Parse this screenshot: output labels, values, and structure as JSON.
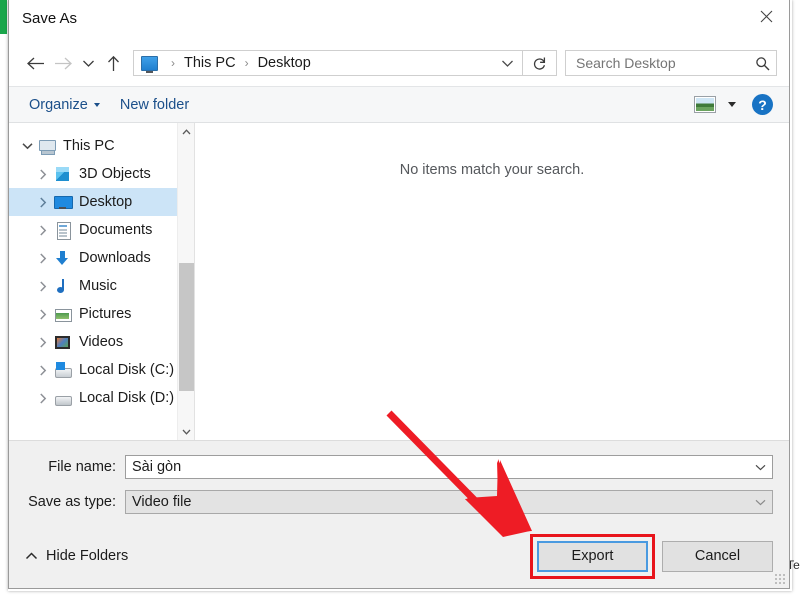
{
  "window": {
    "title": "Save As",
    "close_label": "Close"
  },
  "nav": {
    "back_label": "Back",
    "forward_label": "Forward",
    "recent_label": "Recent locations",
    "up_label": "Up",
    "refresh_label": "Refresh"
  },
  "address": {
    "icon": "desktop-monitor-icon",
    "crumbs": [
      "This PC",
      "Desktop"
    ],
    "separator": "›",
    "dropdown_icon": "chevron-down-icon",
    "refresh_icon": "refresh-icon"
  },
  "search": {
    "placeholder": "Search Desktop",
    "icon": "search-icon"
  },
  "toolbar": {
    "organize_label": "Organize",
    "new_folder_label": "New folder",
    "view_icon": "picture-view-icon",
    "view_caret_icon": "chevron-down-icon",
    "help_label": "?",
    "help_icon": "help-icon"
  },
  "sidebar": {
    "items": [
      {
        "label": "This PC",
        "icon": "computer-icon",
        "level": 0,
        "expander": "⌄",
        "expanded": true,
        "selected": false
      },
      {
        "label": "3D Objects",
        "icon": "3d-objects-icon",
        "level": 1,
        "expander": "›",
        "expanded": false,
        "selected": false
      },
      {
        "label": "Desktop",
        "icon": "desktop-icon",
        "level": 1,
        "expander": "›",
        "expanded": false,
        "selected": true
      },
      {
        "label": "Documents",
        "icon": "documents-icon",
        "level": 1,
        "expander": "›",
        "expanded": false,
        "selected": false
      },
      {
        "label": "Downloads",
        "icon": "downloads-icon",
        "level": 1,
        "expander": "›",
        "expanded": false,
        "selected": false
      },
      {
        "label": "Music",
        "icon": "music-icon",
        "level": 1,
        "expander": "›",
        "expanded": false,
        "selected": false
      },
      {
        "label": "Pictures",
        "icon": "pictures-icon",
        "level": 1,
        "expander": "›",
        "expanded": false,
        "selected": false
      },
      {
        "label": "Videos",
        "icon": "videos-icon",
        "level": 1,
        "expander": "›",
        "expanded": false,
        "selected": false
      },
      {
        "label": "Local Disk (C:)",
        "icon": "disk-c-icon",
        "level": 1,
        "expander": "›",
        "expanded": false,
        "selected": false
      },
      {
        "label": "Local Disk (D:)",
        "icon": "disk-d-icon",
        "level": 1,
        "expander": "›",
        "expanded": false,
        "selected": false
      }
    ],
    "scrollbar": {
      "up_icon": "chevron-up-icon",
      "down_icon": "chevron-down-icon"
    }
  },
  "file_list": {
    "empty_message": "No items match your search."
  },
  "form": {
    "file_name_label": "File name:",
    "file_name_value": "Sài gòn",
    "save_as_type_label": "Save as type:",
    "save_as_type_value": "Video file",
    "dropdown_icon": "chevron-down-icon"
  },
  "footer": {
    "hide_folders_label": "Hide Folders",
    "hide_folders_icon": "chevron-up-icon",
    "export_label": "Export",
    "cancel_label": "Cancel",
    "resize_grip_icon": "resize-grip-icon"
  },
  "annotation": {
    "arrow_color": "#EE1C25",
    "highlight_color": "#E8141B",
    "arrow_name": "red-pointer-arrow",
    "highlight_name": "export-button-highlight"
  },
  "background": {
    "accent_strip_color": "#1AA64B",
    "partial_text": "Te"
  }
}
